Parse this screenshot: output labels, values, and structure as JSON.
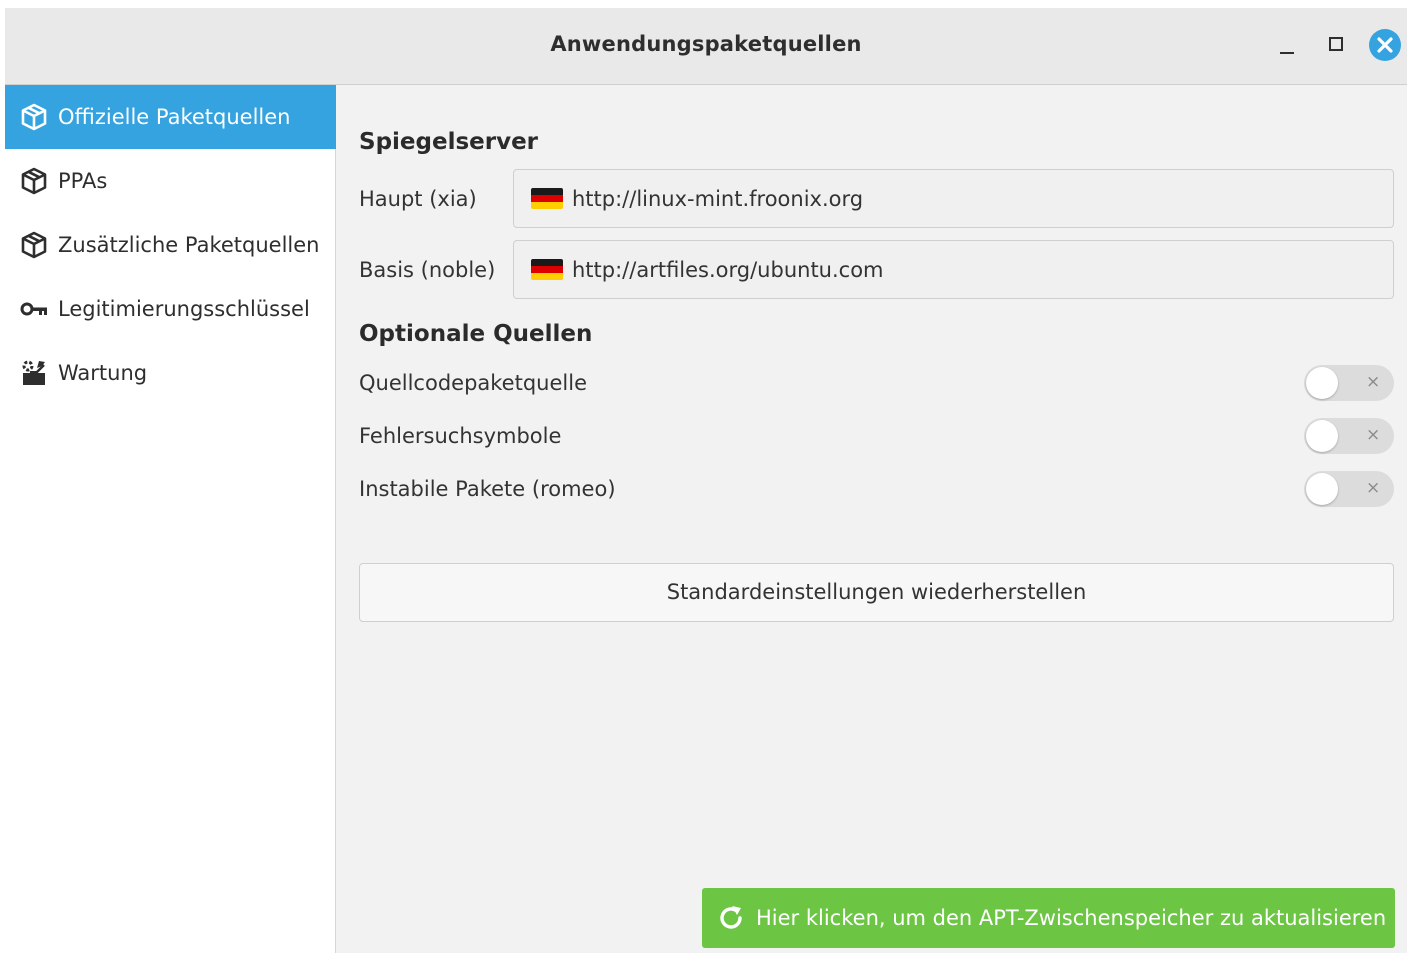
{
  "window": {
    "title": "Anwendungspaketquellen",
    "controls": {
      "minimize_icon": "minimize-icon",
      "maximize_icon": "maximize-icon",
      "close_icon": "close-icon"
    },
    "accent_color": "#35a3e0"
  },
  "sidebar": {
    "items": [
      {
        "label": "Offizielle Paketquellen",
        "icon": "package-icon",
        "active": true
      },
      {
        "label": "PPAs",
        "icon": "package-icon",
        "active": false
      },
      {
        "label": "Zusätzliche Paketquellen",
        "icon": "package-icon",
        "active": false
      },
      {
        "label": "Legitimierungsschlüssel",
        "icon": "key-icon",
        "active": false
      },
      {
        "label": "Wartung",
        "icon": "tools-icon",
        "active": false
      }
    ]
  },
  "mirrors": {
    "title": "Spiegelserver",
    "main": {
      "label": "Haupt (xia)",
      "url": "http://linux-mint.froonix.org",
      "flag": "de-flag-icon"
    },
    "base": {
      "label": "Basis (noble)",
      "url": "http://artfiles.org/ubuntu.com",
      "flag": "de-flag-icon"
    }
  },
  "optional": {
    "title": "Optionale Quellen",
    "items": [
      {
        "label": "Quellcodepaketquelle",
        "enabled": false,
        "off_glyph": "×"
      },
      {
        "label": "Fehlersuchsymbole",
        "enabled": false,
        "off_glyph": "×"
      },
      {
        "label": "Instabile Pakete (romeo)",
        "enabled": false,
        "off_glyph": "×"
      }
    ]
  },
  "reset_button": {
    "label": "Standardeinstellungen wiederherstellen"
  },
  "update_button": {
    "label": "Hier klicken, um den APT-Zwischenspeicher zu aktualisieren",
    "icon": "refresh-icon",
    "color": "#6cc644"
  }
}
